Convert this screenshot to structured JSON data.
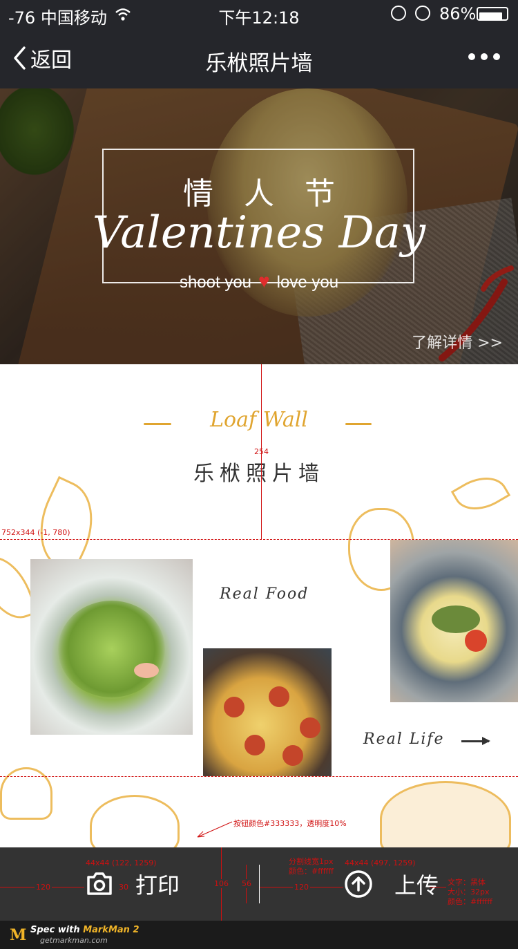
{
  "status_bar": {
    "carrier": "-76 中国移动",
    "time": "下午12:18",
    "battery_percent": "86%",
    "battery_level": 0.86
  },
  "nav": {
    "back_label": "返回",
    "title": "乐栿照片墙"
  },
  "banner": {
    "title_cn": "情人节",
    "title_en": "Valentines Day",
    "tag_left": "shoot you",
    "tag_right": "love you",
    "more_link": "了解详情 >>"
  },
  "section": {
    "script_title": "Loaf Wall",
    "title": "乐栿照片墙"
  },
  "gallery": {
    "caption_top": "Real Food",
    "caption_bottom": "Real Life"
  },
  "toolbar": {
    "print_label": "打印",
    "upload_label": "上传"
  },
  "annotations": {
    "dim_254": "254",
    "area_size": "752x344 (-1, 780)",
    "button_color_note": "按钮颜色#333333，透明度10%",
    "print_icon_spec": "44x44 (122, 1259)",
    "upload_icon_spec": "44x44 (497, 1259)",
    "divider_spec_1": "分割线宽1px",
    "divider_spec_2": "颜色：#ffffff",
    "dim_120_left": "120",
    "dim_30": "30",
    "dim_106": "106",
    "dim_56": "56",
    "dim_120_mid": "120",
    "text_spec_1": "文字：黑体",
    "text_spec_2": "大小：32px",
    "text_spec_3": "颜色：#ffffff"
  },
  "footer": {
    "logo_letter": "M",
    "brand_prefix": "Spec with ",
    "brand_name": "MarkMan 2",
    "site": "getmarkman.com"
  },
  "colors": {
    "nav_bg": "#25262b",
    "accent_yellow": "#e0a530",
    "toolbar_bg": "#333333",
    "annotation_red": "#d01010",
    "heart_red": "#e02d2d"
  }
}
